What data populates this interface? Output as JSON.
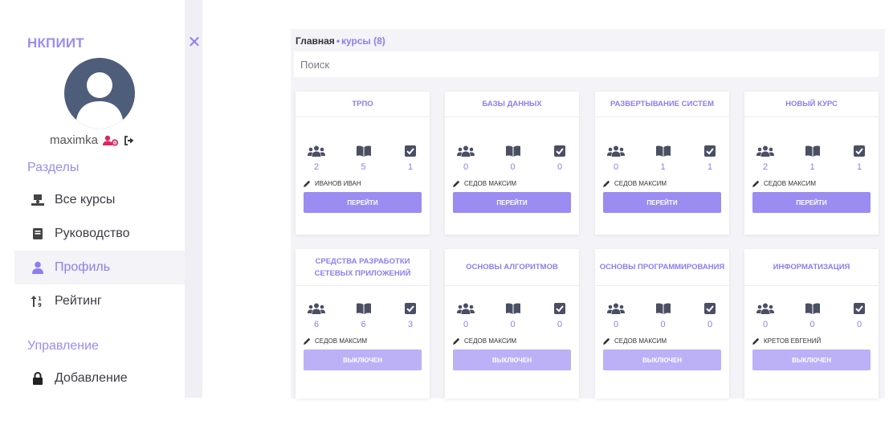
{
  "sidebar": {
    "brand": "НКПИИТ",
    "username": "maximka",
    "sections_title": "Разделы",
    "items": [
      {
        "label": "Все курсы",
        "icon": "courses-icon"
      },
      {
        "label": "Руководство",
        "icon": "book-icon"
      },
      {
        "label": "Профиль",
        "icon": "user-icon"
      },
      {
        "label": "Рейтинг",
        "icon": "sort-icon"
      }
    ],
    "manage_title": "Управление",
    "manage_items": [
      {
        "label": "Добавление",
        "icon": "lock-icon"
      }
    ]
  },
  "breadcrumb": {
    "home": "Главная",
    "separator": "•",
    "current": "курсы (8)"
  },
  "search": {
    "placeholder": "Поиск"
  },
  "cards": [
    {
      "title": "ТРПО",
      "students": "2",
      "lessons": "5",
      "tasks": "1",
      "teacher": "Иванов Иван",
      "button": "Перейти",
      "enabled": true
    },
    {
      "title": "БАЗЫ ДАННЫХ",
      "students": "0",
      "lessons": "0",
      "tasks": "0",
      "teacher": "Седов Максим",
      "button": "Перейти",
      "enabled": true
    },
    {
      "title": "РАЗВЕРТЫВАНИЕ СИСТЕМ",
      "students": "0",
      "lessons": "1",
      "tasks": "1",
      "teacher": "Седов Максим",
      "button": "Перейти",
      "enabled": true
    },
    {
      "title": "НОВЫЙ КУРС",
      "students": "2",
      "lessons": "1",
      "tasks": "1",
      "teacher": "Седов Максим",
      "button": "Перейти",
      "enabled": true
    },
    {
      "title": "СРЕДСТВА РАЗРАБОТКИ СЕТЕВЫХ ПРИЛОЖЕНИЙ",
      "students": "6",
      "lessons": "6",
      "tasks": "3",
      "teacher": "Седов Максим",
      "button": "Выключен",
      "enabled": false
    },
    {
      "title": "ОСНОВЫ АЛГОРИТМОВ",
      "students": "0",
      "lessons": "0",
      "tasks": "0",
      "teacher": "Седов Максим",
      "button": "Выключен",
      "enabled": false
    },
    {
      "title": "ОСНОВЫ ПРОГРАММИРОВАНИЯ",
      "students": "0",
      "lessons": "0",
      "tasks": "0",
      "teacher": "Седов Максим",
      "button": "Выключен",
      "enabled": false
    },
    {
      "title": "ИНФОРМАТИЗАЦИЯ",
      "students": "0",
      "lessons": "0",
      "tasks": "0",
      "teacher": "Кретов Евгений",
      "button": "Выключен",
      "enabled": false
    }
  ],
  "colors": {
    "accent": "#9b8cf2",
    "accent_disabled": "#bcb1f6",
    "background": "#f4f4f8",
    "card_icon": "#4a4f63",
    "user_badge": "#e0245e"
  }
}
